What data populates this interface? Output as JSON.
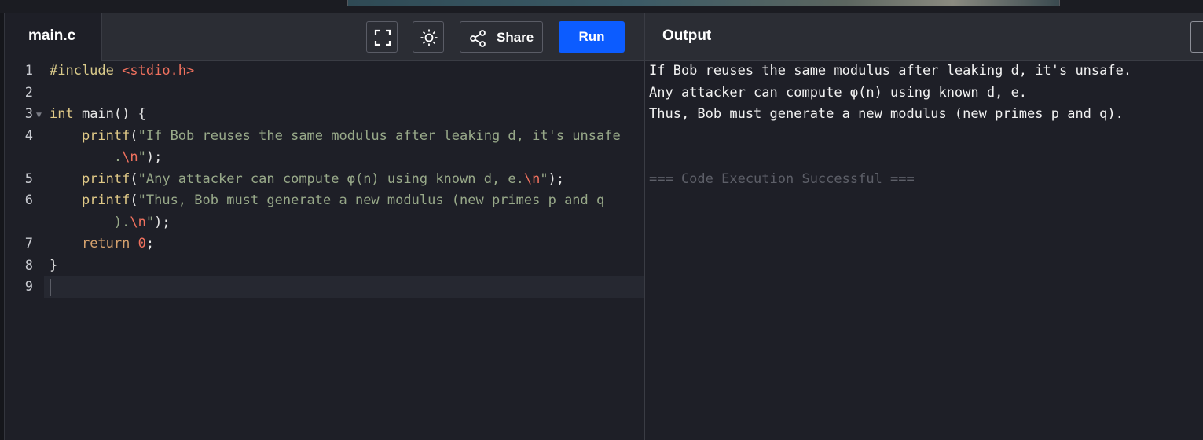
{
  "editor": {
    "tab_label": "main.c",
    "share_label": "Share",
    "run_label": "Run",
    "line_numbers": [
      "1",
      "2",
      "3",
      "4",
      "5",
      "6",
      "7",
      "8",
      "9"
    ],
    "lines": {
      "l1_directive": "#include",
      "l1_header": "<stdio.h>",
      "l3_type": "int",
      "l3_rest": " main() {",
      "l4_fn": "printf",
      "l4_open": "(",
      "l4_str": "\"If Bob reuses the same modulus after leaking d, it's unsafe",
      "l4b_str": ".",
      "l4b_esc": "\\n",
      "l4b_strend": "\"",
      "l4b_close": ");",
      "l5_fn": "printf",
      "l5_open": "(",
      "l5_str": "\"Any attacker can compute φ(n) using known d, e.",
      "l5_esc": "\\n",
      "l5_strend": "\"",
      "l5_close": ");",
      "l6_fn": "printf",
      "l6_open": "(",
      "l6_str": "\"Thus, Bob must generate a new modulus (new primes p and q",
      "l6b_str": ").",
      "l6b_esc": "\\n",
      "l6b_strend": "\"",
      "l6b_close": ");",
      "l7_kw": "return",
      "l7_num": "0",
      "l7_end": ";",
      "l8_brace": "}"
    }
  },
  "output": {
    "title": "Output",
    "lines": [
      "If Bob reuses the same modulus after leaking d, it's unsafe.",
      "Any attacker can compute φ(n) using known d, e.",
      "Thus, Bob must generate a new modulus (new primes p and q)."
    ],
    "status": "=== Code Execution Successful ==="
  },
  "icons": {
    "fullscreen": "fullscreen-icon",
    "theme": "sun-icon",
    "share": "share-icon",
    "fold": "fold-arrow-icon"
  },
  "colors": {
    "run_button": "#0c5cff",
    "background": "#1e1f27",
    "header": "#2b2d34"
  }
}
